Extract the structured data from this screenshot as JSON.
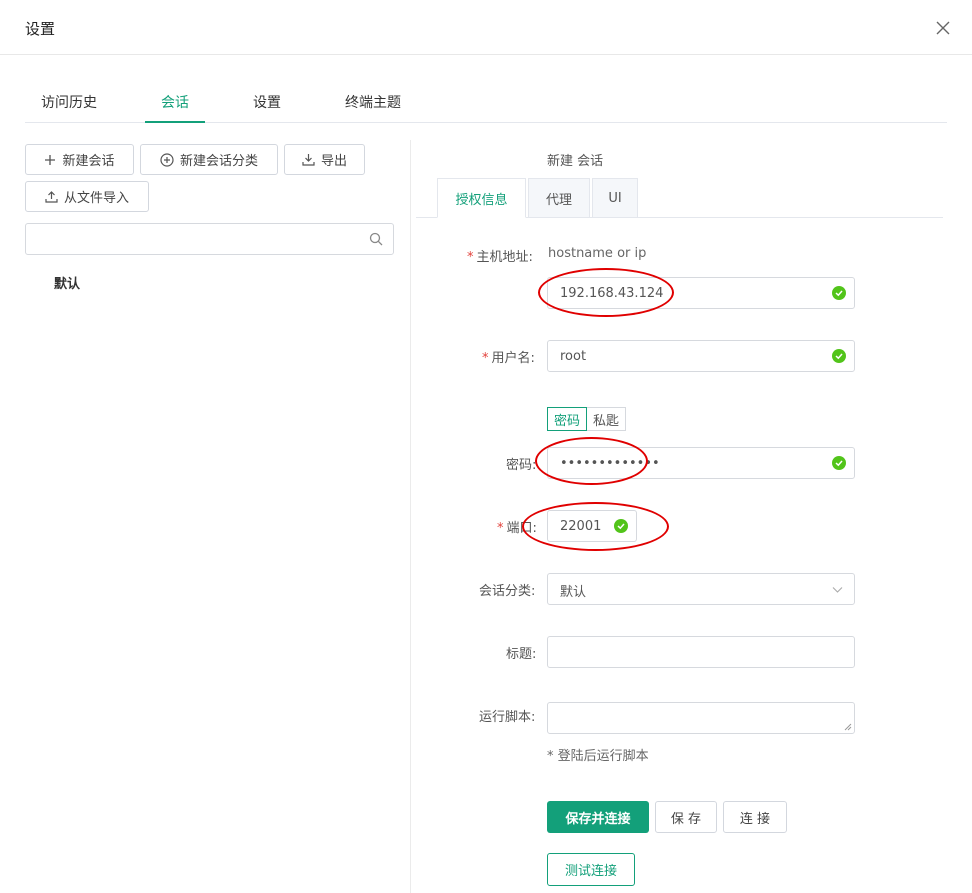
{
  "dialog": {
    "title": "设置"
  },
  "tabs": {
    "history": "访问历史",
    "sessions": "会话",
    "settings": "设置",
    "terminal_theme": "终端主题"
  },
  "left": {
    "new_session": "新建会话",
    "new_category": "新建会话分类",
    "export": "导出",
    "import_file": "从文件导入",
    "search_placeholder": "",
    "group_default": "默认"
  },
  "right": {
    "title": "新建 会话",
    "subtabs": {
      "auth": "授权信息",
      "proxy": "代理",
      "ui": "UI"
    },
    "form": {
      "host_label": "主机地址",
      "host_hint": "hostname or ip",
      "host_value": "192.168.43.124",
      "username_label": "用户名",
      "username_value": "root",
      "auth_password": "密码",
      "auth_key": "私匙",
      "password_label": "密码",
      "password_value": "•••••••••••••",
      "port_label": "端口",
      "port_value": "22001",
      "category_label": "会话分类",
      "category_value": "默认",
      "title_label": "标题",
      "title_value": "",
      "script_label": "运行脚本",
      "script_hint": "* 登陆后运行脚本",
      "colon": ":"
    },
    "buttons": {
      "save_connect": "保存并连接",
      "save": "保 存",
      "connect": "连 接",
      "test": "测试连接"
    }
  },
  "colors": {
    "accent": "#13a07a",
    "valid": "#52c41a",
    "required": "#e2403a",
    "annotation": "#e00000"
  }
}
